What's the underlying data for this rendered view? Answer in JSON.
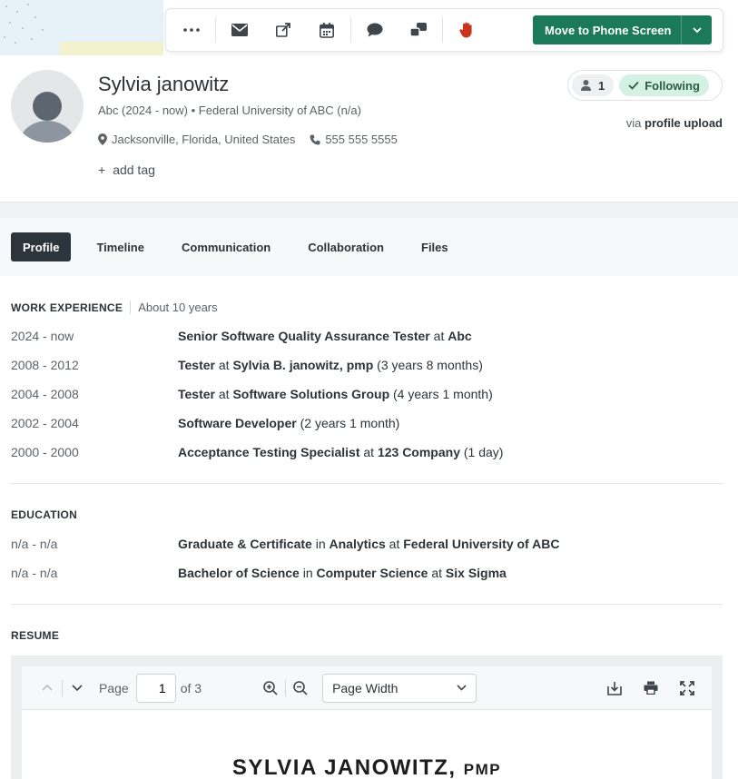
{
  "toolbar": {
    "more_icon": "more-horizontal-icon",
    "email_icon": "envelope-icon",
    "move_label": "Move to Phone Screen",
    "accent": "#1b7a5a"
  },
  "candidate": {
    "name": "Sylvia janowitz",
    "current_company": "Abc (2024 - now)",
    "education_short": "Federal University of ABC (n/a)",
    "location": "Jacksonville, Florida, United States",
    "phone": "555 555 5555",
    "add_tag_label": "add tag",
    "follower_count": "1",
    "follow_label": "Following",
    "source_prefix": "via",
    "source": "profile upload"
  },
  "tabs": [
    {
      "label": "Profile",
      "active": true
    },
    {
      "label": "Timeline"
    },
    {
      "label": "Communication"
    },
    {
      "label": "Collaboration"
    },
    {
      "label": "Files"
    }
  ],
  "work": {
    "title": "WORK EXPERIENCE",
    "summary": "About 10 years",
    "items": [
      {
        "date": "2024 - now",
        "role": "Senior Software Quality Assurance Tester",
        "at": "at",
        "company": "Abc",
        "duration": ""
      },
      {
        "date": "2008 - 2012",
        "role": "Tester",
        "at": "at",
        "company": "Sylvia B. janowitz, pmp",
        "duration": "(3 years 8 months)"
      },
      {
        "date": "2004 - 2008",
        "role": "Tester",
        "at": "at",
        "company": "Software Solutions Group",
        "duration": "(4 years 1 month)"
      },
      {
        "date": "2002 - 2004",
        "role": "Software Developer",
        "at": "",
        "company": "",
        "duration": "(2 years 1 month)"
      },
      {
        "date": "2000 - 2000",
        "role": "Acceptance Testing Specialist",
        "at": "at",
        "company": "123 Company",
        "duration": "(1 day)"
      }
    ]
  },
  "education": {
    "title": "EDUCATION",
    "items": [
      {
        "date": "n/a - n/a",
        "degree": "Graduate & Certificate",
        "in": "in",
        "field": "Analytics",
        "at": "at",
        "school": "Federal University of ABC"
      },
      {
        "date": "n/a - n/a",
        "degree": "Bachelor of Science",
        "in": "in",
        "field": "Computer Science",
        "at": "at",
        "school": "Six Sigma"
      }
    ]
  },
  "resume": {
    "title": "RESUME",
    "page_label": "Page",
    "page_value": "1",
    "page_total": "of 3",
    "zoom_mode": "Page Width",
    "doc_name": "SYLVIA JANOWITZ,",
    "doc_cred": "PMP"
  }
}
